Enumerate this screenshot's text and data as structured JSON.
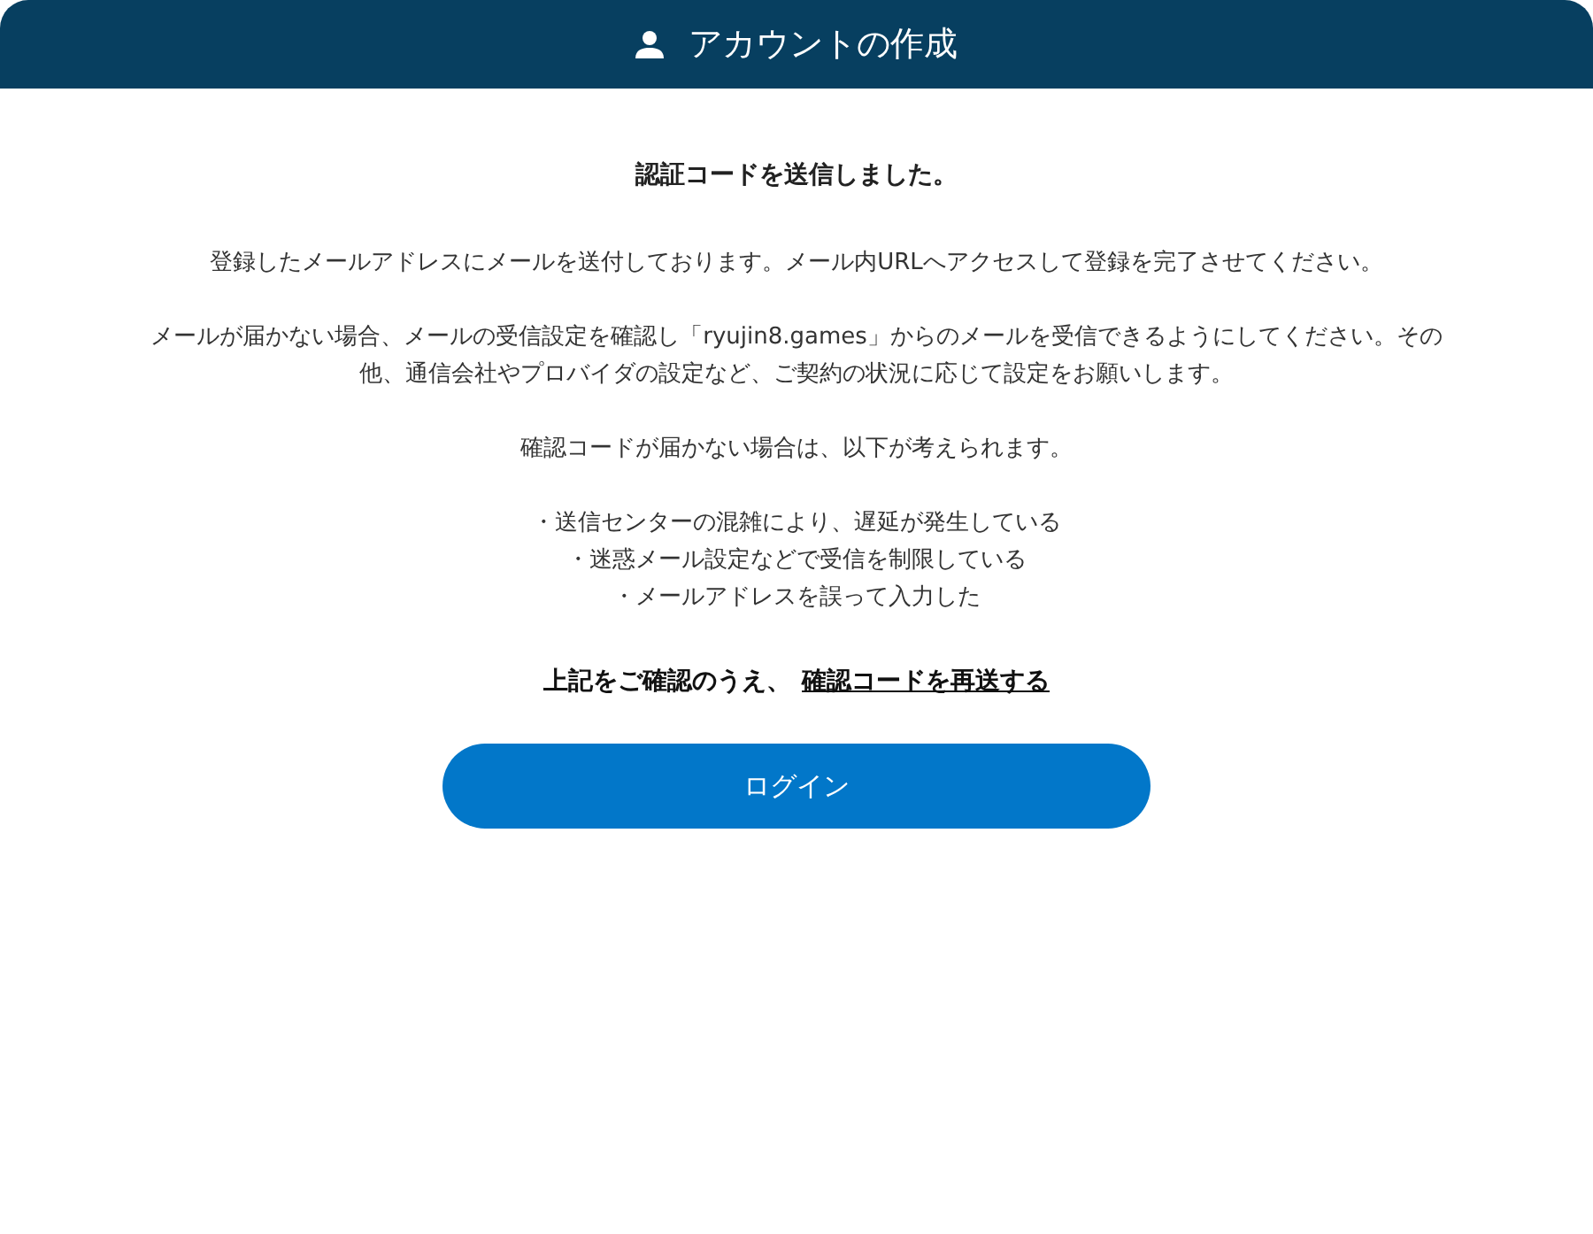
{
  "header": {
    "title": "アカウントの作成"
  },
  "heading": "認証コードを送信しました。",
  "paragraphs": [
    "登録したメールアドレスにメールを送付しております。メール内URLへアクセスして登録を完了させてください。",
    "メールが届かない場合、メールの受信設定を確認し「ryujin8.games」からのメールを受信できるようにしてください。その他、通信会社やプロバイダの設定など、ご契約の状況に応じて設定をお願いします。",
    "確認コードが届かない場合は、以下が考えられます。"
  ],
  "reasons": [
    "・送信センターの混雑により、遅延が発生している",
    "・迷惑メール設定などで受信を制限している",
    "・メールアドレスを誤って入力した"
  ],
  "resend": {
    "prefix": "上記をご確認のうえ、",
    "link": "確認コードを再送する"
  },
  "login_button": "ログイン"
}
